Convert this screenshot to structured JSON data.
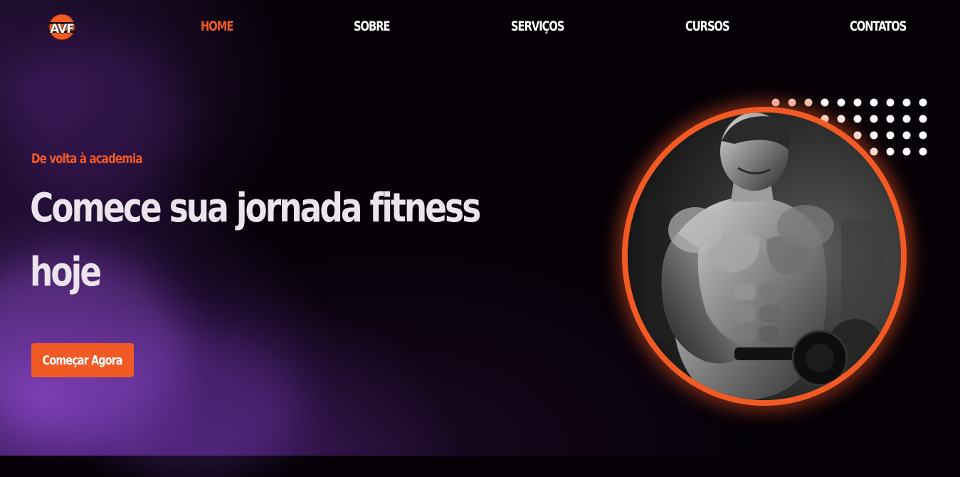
{
  "brand": {
    "logo_text": "AVF",
    "accent_color": "#f15a24"
  },
  "nav": {
    "items": [
      {
        "label": "HOME",
        "active": true
      },
      {
        "label": "SOBRE",
        "active": false
      },
      {
        "label": "SERVIÇOS",
        "active": false
      },
      {
        "label": "CURSOS",
        "active": false
      },
      {
        "label": "CONTATOS",
        "active": false
      }
    ]
  },
  "hero": {
    "subtitle": "De volta à academia",
    "title_line1": "Comece sua jornada fitness",
    "title_line2": "hoje",
    "cta_label": "Começar Agora",
    "image_icon": "bodybuilder-photo"
  }
}
